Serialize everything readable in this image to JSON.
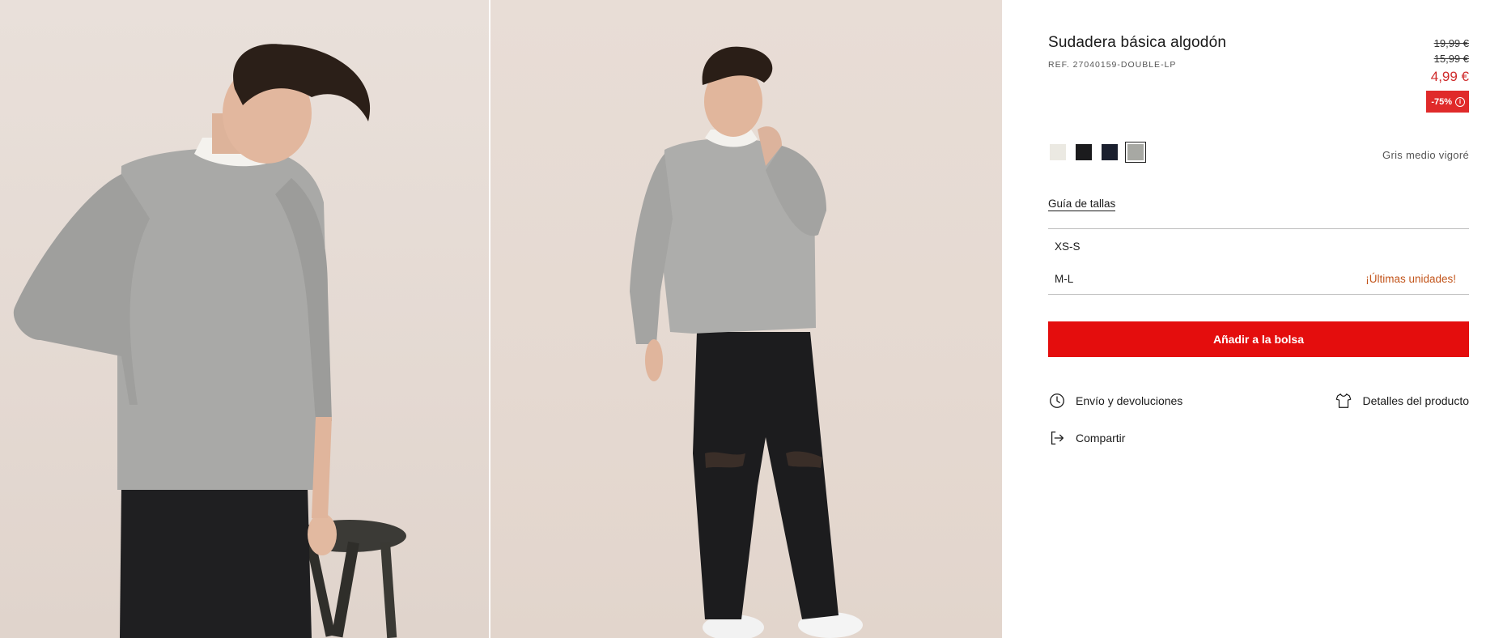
{
  "product": {
    "title": "Sudadera básica algodón",
    "ref": "REF. 27040159-DOUBLE-LP",
    "prices": {
      "original": "19,99 €",
      "previous": "15,99 €",
      "current": "4,99 €",
      "discount": "-75%",
      "discount_info_glyph": "i"
    },
    "colors": [
      {
        "name": "swatch-offwhite",
        "hex": "#ebe9e2"
      },
      {
        "name": "swatch-black",
        "hex": "#1b1b1d"
      },
      {
        "name": "swatch-navy",
        "hex": "#1a1f2e"
      },
      {
        "name": "swatch-grey",
        "hex": "#a7a8a3",
        "selected": true
      }
    ],
    "selected_color": "Gris medio vigoré",
    "size_guide": "Guía de tallas",
    "sizes": [
      {
        "label": "XS-S",
        "note": ""
      },
      {
        "label": "M-L",
        "note": "¡Últimas unidades!"
      }
    ],
    "add_to_bag": "Añadir a la bolsa",
    "links": {
      "shipping": "Envío y devoluciones",
      "details": "Detalles del producto",
      "share": "Compartir"
    }
  },
  "colors": {
    "accent_red": "#e40d0d",
    "price_red": "#cf2a2a",
    "last_units": "#c2541a",
    "photo_bg": "#e7dcd5"
  },
  "icons": {
    "shipping": "clock-icon",
    "details": "tshirt-icon",
    "share": "share-exit-icon",
    "discount_info": "info-icon"
  }
}
